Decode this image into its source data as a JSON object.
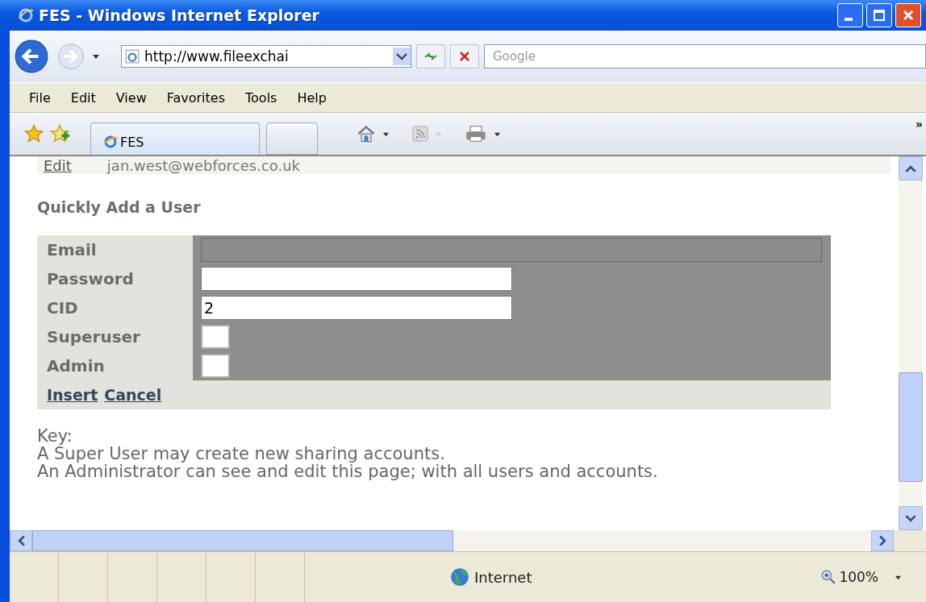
{
  "window": {
    "title": "FES - Windows Internet Explorer"
  },
  "address_bar": {
    "value": "http://www.fileexchai"
  },
  "search": {
    "placeholder": "Google"
  },
  "menu": [
    "File",
    "Edit",
    "View",
    "Favorites",
    "Tools",
    "Help"
  ],
  "tabs": [
    {
      "label": "FES",
      "selected": true
    }
  ],
  "toolbar_more": "»",
  "top_row": {
    "link": "Edit",
    "email": "jan.west@webforces.co.uk"
  },
  "heading": "Quickly Add a User",
  "fields": [
    {
      "label": "Email",
      "kind": "text",
      "disabled": true
    },
    {
      "label": "Password",
      "kind": "text",
      "disabled": false
    },
    {
      "label": "CID",
      "kind": "text",
      "disabled": false,
      "value": "2"
    },
    {
      "label": "Superuser",
      "kind": "checkbox",
      "checked": false
    },
    {
      "label": "Admin",
      "kind": "checkbox",
      "checked": false
    }
  ],
  "actions": [
    "Insert",
    "Cancel"
  ],
  "key": [
    "Key:",
    "A Super User may create new sharing accounts.",
    "An Administrator can see and edit this page; with all users and accounts."
  ],
  "status_bar": {
    "zone": "Internet",
    "zoom": "100%"
  }
}
